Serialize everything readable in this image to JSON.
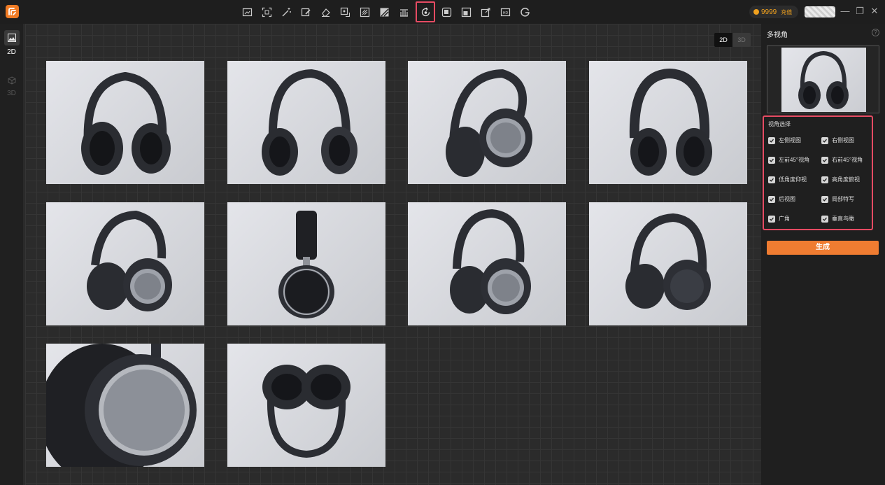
{
  "topbar": {
    "tools": [
      {
        "icon": "image-expand-icon"
      },
      {
        "icon": "scan-frame-icon"
      },
      {
        "icon": "magic-wand-icon"
      },
      {
        "icon": "image-edit-icon"
      },
      {
        "icon": "eraser-icon"
      },
      {
        "icon": "image-replace-icon"
      },
      {
        "icon": "texture-icon"
      },
      {
        "icon": "stripe-icon"
      },
      {
        "icon": "lineup-icon"
      },
      {
        "icon": "multi-view-rotate-icon",
        "active": true
      },
      {
        "icon": "layer-copy-icon"
      },
      {
        "icon": "crop-square-icon"
      },
      {
        "icon": "image-export-icon"
      },
      {
        "icon": "hd-upscale-icon"
      },
      {
        "icon": "g-logo-icon"
      }
    ],
    "coins": "9999",
    "recharge": "充值",
    "accent": "#f0a11e",
    "active_outline": "#e64b63"
  },
  "leftbar": {
    "items": [
      {
        "label": "2D",
        "icon": "image-icon",
        "active": true
      },
      {
        "label": "3D",
        "icon": "cube-icon",
        "active": false
      }
    ]
  },
  "canvas": {
    "mode_2d": "2D",
    "mode_3d": "3D",
    "collapse_icon": "chevron-left-icon"
  },
  "right_panel": {
    "title": "多视角",
    "help_icon": "?",
    "angle_section_title": "视角选择",
    "options": [
      {
        "label": "左侧视图",
        "checked": true
      },
      {
        "label": "右侧视图",
        "checked": true
      },
      {
        "label": "左前45°视角",
        "checked": true
      },
      {
        "label": "右前45°视角",
        "checked": true
      },
      {
        "label": "低角度仰视",
        "checked": true
      },
      {
        "label": "高角度俯视",
        "checked": true
      },
      {
        "label": "后视图",
        "checked": true
      },
      {
        "label": "局部特写",
        "checked": true
      },
      {
        "label": "广角",
        "checked": true
      },
      {
        "label": "垂直鸟瞰",
        "checked": true
      }
    ],
    "generate_label": "生成",
    "generate_color": "#ef7c31"
  }
}
